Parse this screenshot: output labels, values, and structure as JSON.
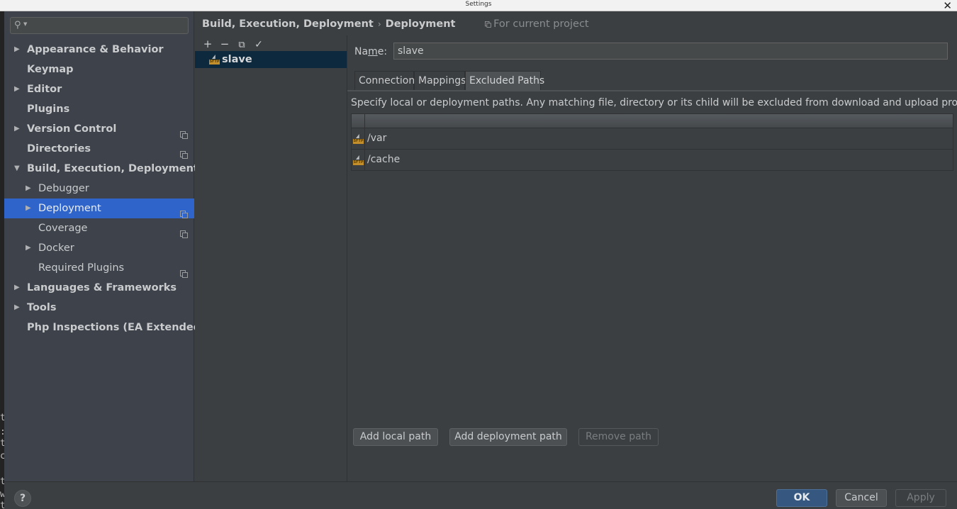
{
  "window": {
    "title": "Settings",
    "close_icon": "close-x-icon"
  },
  "background_fragments": [
    "t",
    ":",
    "t",
    "c",
    "t",
    "w",
    "t"
  ],
  "sidebar": {
    "search_placeholder": "",
    "items": [
      {
        "label": "Appearance & Behavior",
        "level": 0,
        "arrow": "right",
        "bold": true,
        "project": false
      },
      {
        "label": "Keymap",
        "level": 0,
        "arrow": "",
        "bold": true,
        "project": false
      },
      {
        "label": "Editor",
        "level": 0,
        "arrow": "right",
        "bold": true,
        "project": false
      },
      {
        "label": "Plugins",
        "level": 0,
        "arrow": "",
        "bold": true,
        "project": false
      },
      {
        "label": "Version Control",
        "level": 0,
        "arrow": "right",
        "bold": true,
        "project": true
      },
      {
        "label": "Directories",
        "level": 0,
        "arrow": "",
        "bold": true,
        "project": true
      },
      {
        "label": "Build, Execution, Deployment",
        "level": 0,
        "arrow": "down",
        "bold": true,
        "project": false
      },
      {
        "label": "Debugger",
        "level": 1,
        "arrow": "right",
        "bold": false,
        "project": false
      },
      {
        "label": "Deployment",
        "level": 1,
        "arrow": "right",
        "bold": false,
        "project": true,
        "selected": true
      },
      {
        "label": "Coverage",
        "level": 1,
        "arrow": "",
        "bold": false,
        "project": true
      },
      {
        "label": "Docker",
        "level": 1,
        "arrow": "right",
        "bold": false,
        "project": false
      },
      {
        "label": "Required Plugins",
        "level": 1,
        "arrow": "",
        "bold": false,
        "project": true
      },
      {
        "label": "Languages & Frameworks",
        "level": 0,
        "arrow": "right",
        "bold": true,
        "project": false
      },
      {
        "label": "Tools",
        "level": 0,
        "arrow": "right",
        "bold": true,
        "project": false
      },
      {
        "label": "Php Inspections (EA Extended)",
        "level": 0,
        "arrow": "",
        "bold": true,
        "project": false
      }
    ]
  },
  "breadcrumb": {
    "parent": "Build, Execution, Deployment",
    "separator": "›",
    "current": "Deployment",
    "scope": "For current project"
  },
  "servers": {
    "toolbar": {
      "add": "+",
      "remove": "−",
      "copy": "⧉",
      "apply": "✓"
    },
    "items": [
      {
        "name": "slave",
        "type_badge": "SFTP"
      }
    ]
  },
  "detail": {
    "name_label": "Name:",
    "name_value": "slave",
    "tabs": [
      {
        "label": "Connection",
        "active": false
      },
      {
        "label": "Mappings",
        "active": false
      },
      {
        "label": "Excluded Paths",
        "active": true
      }
    ],
    "description": "Specify local or deployment paths. Any matching file, directory or its child will be excluded from download and upload process.",
    "excluded_paths": [
      {
        "path": "/var",
        "type_badge": "SFTP"
      },
      {
        "path": "/cache",
        "type_badge": "SFTP"
      }
    ],
    "buttons": {
      "add_local": "Add local path",
      "add_deployment": "Add deployment path",
      "remove": "Remove path"
    }
  },
  "footer": {
    "help": "?",
    "ok": "OK",
    "cancel": "Cancel",
    "apply": "Apply"
  },
  "colors": {
    "selection": "#2f65ca",
    "server_selection": "#0d293e",
    "primary_button": "#365880",
    "sftp_badge": "#c28f2c"
  }
}
